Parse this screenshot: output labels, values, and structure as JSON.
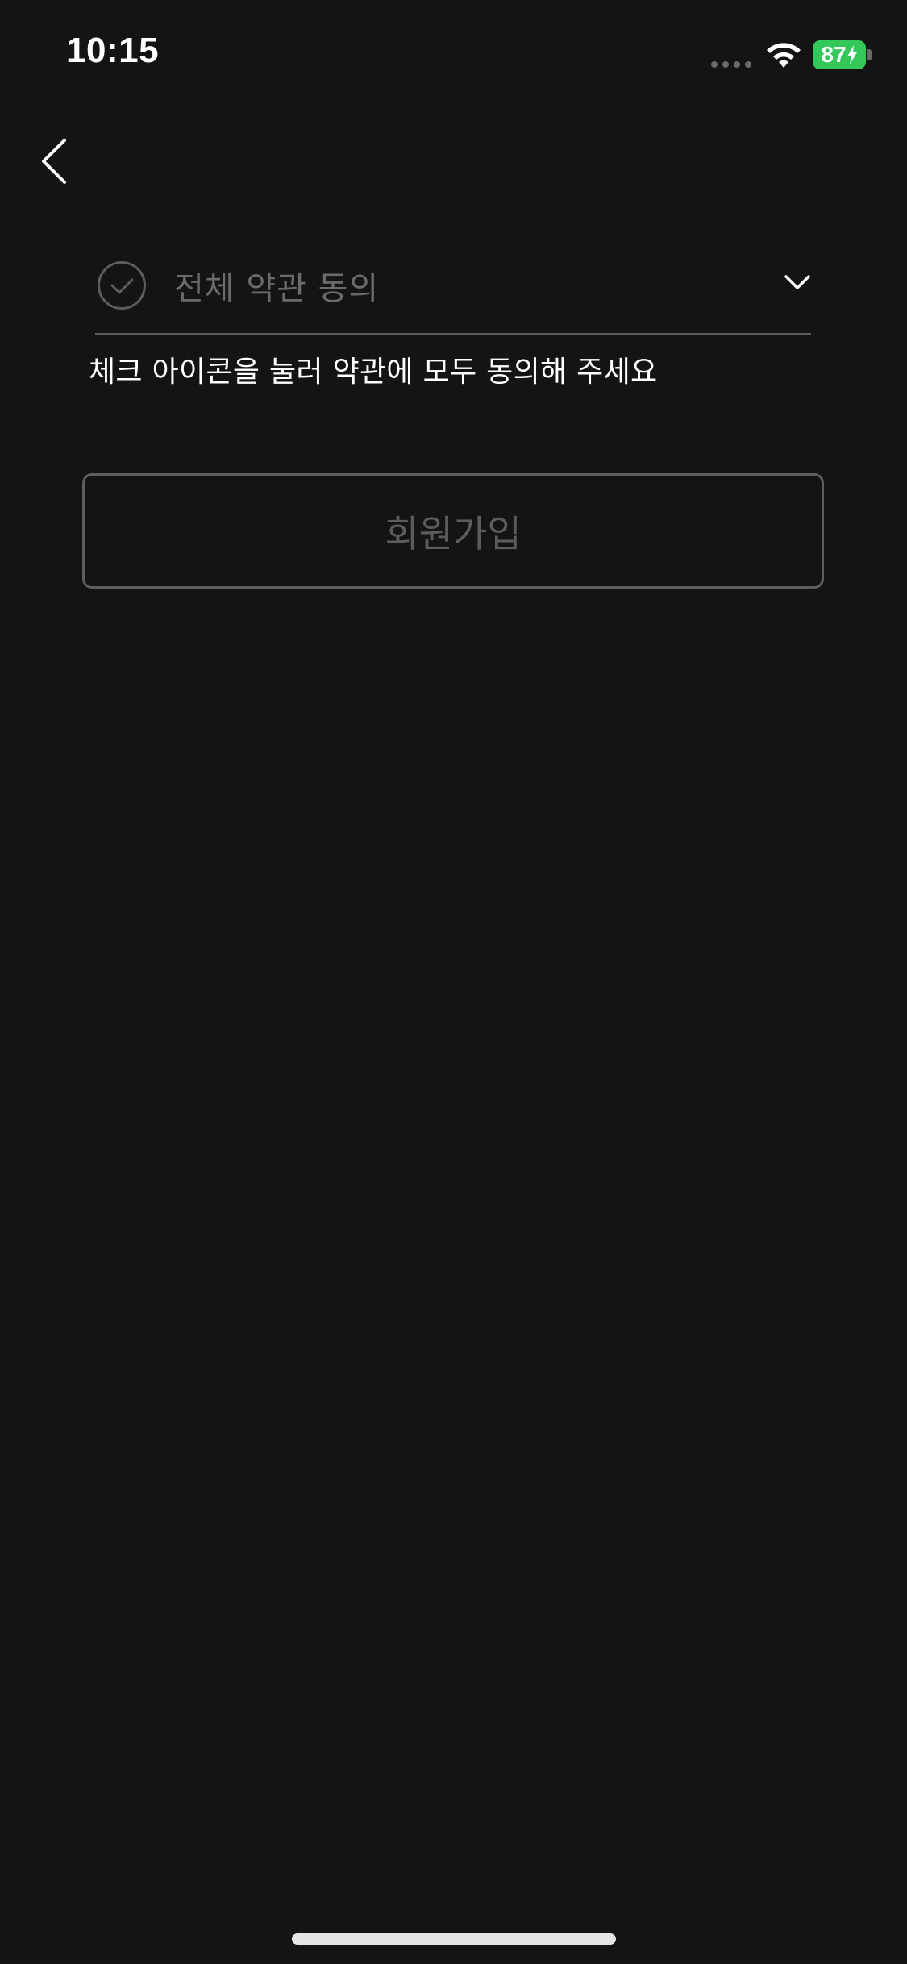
{
  "status_bar": {
    "time": "10:15",
    "battery_percent": "87",
    "battery_color": "#34c759",
    "icons": [
      "signal-dots-icon",
      "wifi-icon",
      "battery-charging-icon"
    ]
  },
  "navigation": {
    "back_icon": "chevron-left-icon"
  },
  "terms": {
    "agree_all_label": "전체 약관 동의",
    "agree_all_checked": false,
    "check_icon": "check-circle-icon",
    "expand_icon": "chevron-down-icon",
    "helper_text": "체크 아이콘을 눌러 약관에 모두 동의해 주세요"
  },
  "actions": {
    "signup_label": "회원가입",
    "signup_enabled": false
  },
  "colors": {
    "background": "#141414",
    "text_primary": "#ffffff",
    "text_disabled": "#5c5c5c",
    "divider": "#5c5c5c"
  }
}
